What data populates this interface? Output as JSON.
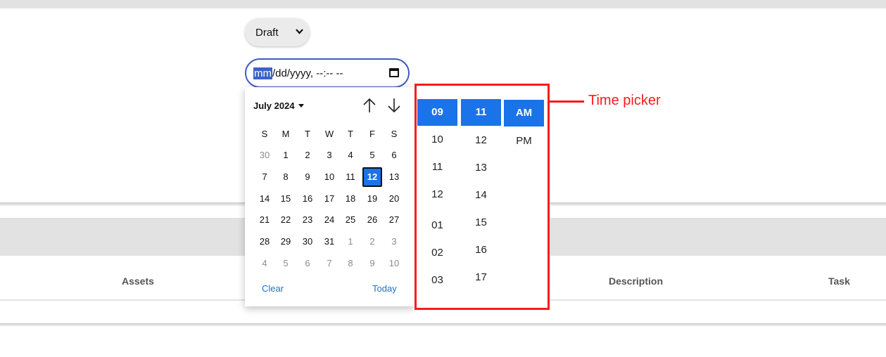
{
  "status_select": {
    "value": "Draft"
  },
  "datetime_input": {
    "highlighted": "mm",
    "rest": "/dd/yyyy, --:-- --"
  },
  "calendar": {
    "month_label": "July 2024",
    "weekdays": [
      "S",
      "M",
      "T",
      "W",
      "T",
      "F",
      "S"
    ],
    "weeks": [
      [
        "30",
        "1",
        "2",
        "3",
        "4",
        "5",
        "6"
      ],
      [
        "7",
        "8",
        "9",
        "10",
        "11",
        "12",
        "13"
      ],
      [
        "14",
        "15",
        "16",
        "17",
        "18",
        "19",
        "20"
      ],
      [
        "21",
        "22",
        "23",
        "24",
        "25",
        "26",
        "27"
      ],
      [
        "28",
        "29",
        "30",
        "31",
        "1",
        "2",
        "3"
      ],
      [
        "4",
        "5",
        "6",
        "7",
        "8",
        "9",
        "10"
      ]
    ],
    "selected_day": "12",
    "clear_label": "Clear",
    "today_label": "Today"
  },
  "time_picker": {
    "hours": [
      "09",
      "10",
      "11",
      "12",
      "01",
      "02",
      "03"
    ],
    "minutes": [
      "11",
      "12",
      "13",
      "14",
      "15",
      "16",
      "17"
    ],
    "periods": [
      "AM",
      "PM"
    ],
    "selected_hour": "09",
    "selected_minute": "11",
    "selected_period": "AM"
  },
  "annotation": {
    "label": "Time picker"
  },
  "table": {
    "headers": [
      "Assets",
      "Description",
      "Task"
    ]
  },
  "colors": {
    "accent": "#1a73e8",
    "annotation": "#ff1a1a",
    "input_border": "#3e5bbd"
  }
}
